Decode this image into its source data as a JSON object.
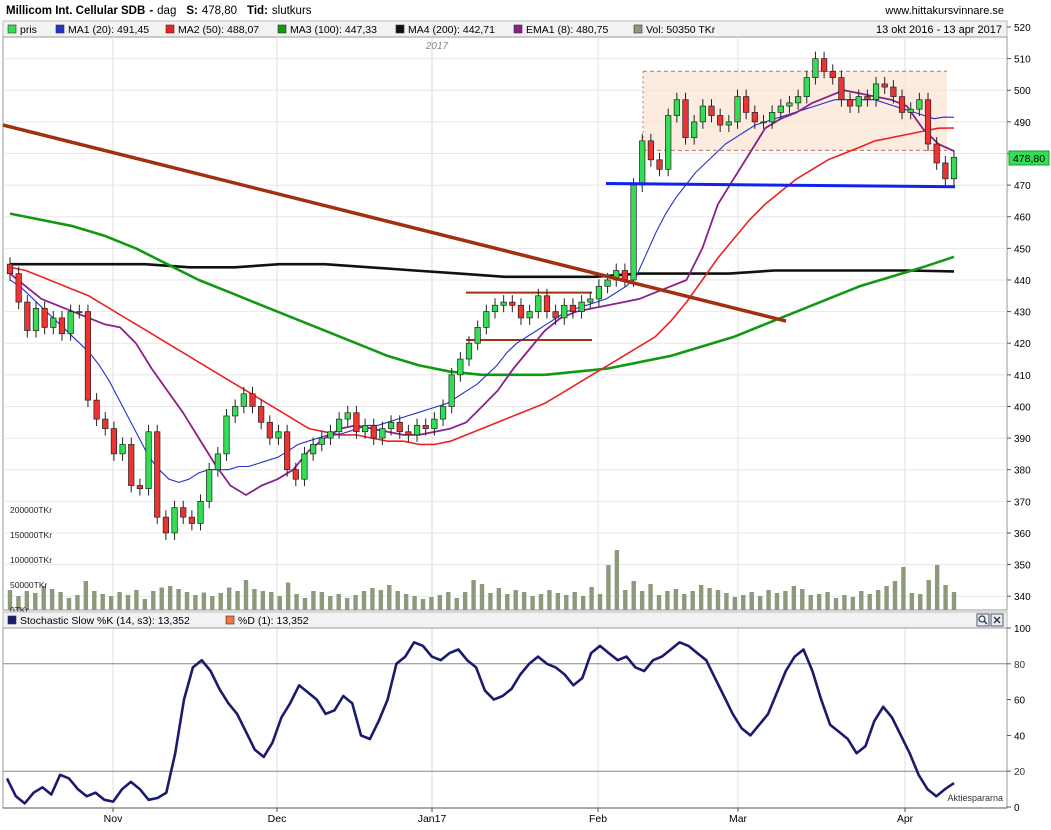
{
  "header": {
    "title": "Millicom Int. Cellular SDB",
    "sep": "-",
    "period": "dag",
    "s_label": "S:",
    "s_value": "478,80",
    "tid_label": "Tid:",
    "tid_value": "slutkurs",
    "site": "www.hittakursvinnare.se",
    "range": "13 okt 2016 - 13 apr 2017"
  },
  "legend": [
    {
      "label": "pris",
      "color": "#33dd55"
    },
    {
      "label": "MA1 (20): 491,45",
      "color": "#2233cc"
    },
    {
      "label": "MA2 (50): 488,07",
      "color": "#ee2222"
    },
    {
      "label": "MA3 (100): 447,33",
      "color": "#119911"
    },
    {
      "label": "MA4 (200): 442,71",
      "color": "#111111"
    },
    {
      "label": "EMA1 (8): 480,75",
      "color": "#882288"
    },
    {
      "label": "Vol: 50350 TKr",
      "color": "#8a9a7a"
    }
  ],
  "stoch_legend": [
    {
      "label": "Stochastic Slow %K (14, s3): 13,352",
      "color": "#1a1a6e"
    },
    {
      "label": "%D (1): 13,352",
      "color": "#ee7744"
    }
  ],
  "year_label": "2017",
  "last_price_tag": "478,80",
  "watermark": "Aktiespararna",
  "colors": {
    "up": "#33dd55",
    "down": "#ee3333",
    "ma20": "#2233cc",
    "ma50": "#ee2222",
    "ma100": "#119911",
    "ma200": "#111111",
    "ema8": "#882288",
    "volume": "#8a9a7a",
    "trend": "#a03010",
    "support": "#1122ee",
    "stoch": "#1a1a6e"
  },
  "chart_data": [
    {
      "type": "candlestick",
      "xlabels": [
        "Nov",
        "Dec",
        "Jan17",
        "Feb",
        "Mar",
        "Apr"
      ],
      "ylim": [
        335,
        520
      ],
      "yticks": [
        340,
        350,
        360,
        370,
        380,
        390,
        400,
        410,
        420,
        430,
        440,
        450,
        460,
        470,
        480,
        490,
        500,
        510,
        520
      ],
      "closes": [
        442,
        433,
        424,
        431,
        425,
        428,
        423,
        430,
        430,
        402,
        396,
        393,
        385,
        388,
        375,
        374,
        392,
        365,
        360,
        368,
        365,
        363,
        370,
        380,
        385,
        397,
        400,
        404,
        400,
        395,
        390,
        392,
        380,
        377,
        385,
        388,
        390,
        392,
        396,
        398,
        392,
        394,
        390,
        393,
        395,
        392,
        391,
        394,
        393,
        396,
        400,
        410,
        415,
        420,
        425,
        430,
        432,
        433,
        432,
        428,
        430,
        435,
        430,
        428,
        432,
        430,
        433,
        434,
        438,
        440,
        443,
        440,
        470,
        484,
        478,
        475,
        492,
        497,
        485,
        490,
        495,
        492,
        489,
        490,
        498,
        493,
        490,
        490,
        493,
        495,
        496,
        498,
        504,
        510,
        506,
        504,
        497,
        495,
        498,
        497,
        502,
        501,
        498,
        493,
        494,
        497,
        483,
        477,
        472,
        478.8
      ],
      "ma20": [
        440,
        438,
        435,
        432,
        429,
        426,
        423,
        420,
        417,
        413,
        408,
        402,
        396,
        390,
        384,
        380,
        377,
        376,
        377,
        379,
        380,
        380,
        380,
        381,
        381,
        382,
        383,
        384,
        386,
        388,
        389,
        390,
        391,
        391,
        392,
        393,
        394,
        394,
        395,
        396,
        397,
        398,
        399,
        400,
        401,
        403,
        405,
        407,
        410,
        413,
        417,
        420,
        422,
        424,
        426,
        428,
        430,
        431,
        432,
        433,
        434,
        436,
        438,
        441,
        448,
        455,
        461,
        466,
        470,
        474,
        477,
        480,
        483,
        485,
        487,
        489,
        490,
        491,
        492,
        493,
        494,
        495,
        496,
        497,
        497,
        497,
        497,
        497,
        496,
        495,
        494,
        493,
        492,
        491,
        491.5,
        491.45
      ],
      "ma50": [
        444,
        443,
        441,
        439,
        437,
        435,
        432,
        429,
        426,
        423,
        420,
        417,
        414,
        411,
        408,
        405,
        402,
        399,
        396,
        393,
        392,
        391,
        391,
        390,
        389,
        389,
        388,
        388,
        389,
        391,
        393,
        395,
        397,
        399,
        401,
        404,
        407,
        410,
        413,
        416,
        419,
        422,
        427,
        433,
        440,
        447,
        453,
        459,
        464,
        468,
        472,
        475,
        478,
        480,
        482,
        484,
        485,
        486,
        487,
        488,
        488.07
      ],
      "ma100": [
        461,
        459,
        457,
        454,
        450,
        445,
        440,
        436,
        432,
        428,
        424,
        420,
        416,
        413,
        411,
        410,
        410,
        410,
        411,
        412,
        414,
        416,
        419,
        422,
        426,
        430,
        434,
        438,
        441,
        444,
        447.33
      ],
      "ma200": [
        445,
        445,
        445,
        445,
        444,
        444,
        445,
        445,
        444,
        443,
        442,
        441,
        441,
        441,
        442,
        442,
        442,
        443,
        443,
        443,
        443,
        442.71
      ],
      "ema8": [
        442,
        438,
        434,
        432,
        430,
        428,
        426,
        425,
        420,
        412,
        405,
        398,
        390,
        382,
        375,
        372,
        375,
        377,
        380,
        386,
        390,
        393,
        394,
        393,
        392,
        391,
        391,
        392,
        393,
        395,
        400,
        405,
        412,
        418,
        424,
        428,
        430,
        431,
        432,
        433,
        434,
        436,
        438,
        440,
        450,
        464,
        472,
        480,
        488,
        491,
        493,
        496,
        498,
        500,
        499,
        498,
        497,
        495,
        488,
        483,
        480.75
      ],
      "trend_line": {
        "from": [
          0,
          489
        ],
        "to": [
          107,
          427
        ]
      },
      "resistance": 506,
      "range_bottom": 481,
      "support_line": {
        "from": [
          470.5
        ],
        "to": [
          469.5
        ]
      },
      "consolidation_top": 436,
      "consolidation_bottom": 421
    },
    {
      "type": "bar",
      "name": "Volume",
      "ylabels": [
        "200000TKr",
        "150000TKr",
        "100000TKr",
        "50000TKr",
        "0TKr"
      ],
      "values": [
        40,
        28,
        38,
        34,
        48,
        42,
        36,
        24,
        30,
        58,
        38,
        32,
        28,
        36,
        30,
        40,
        22,
        38,
        45,
        48,
        42,
        36,
        30,
        35,
        28,
        34,
        45,
        38,
        60,
        42,
        38,
        36,
        28,
        55,
        32,
        24,
        38,
        36,
        28,
        32,
        24,
        30,
        38,
        44,
        40,
        50,
        38,
        32,
        28,
        22,
        26,
        30,
        36,
        24,
        36,
        60,
        52,
        34,
        44,
        32,
        40,
        36,
        28,
        32,
        40,
        34,
        30,
        36,
        28,
        46,
        32,
        90,
        120,
        40,
        58,
        38,
        52,
        30,
        38,
        42,
        32,
        38,
        50,
        44,
        40,
        34,
        26,
        30,
        36,
        28,
        40,
        34,
        38,
        48,
        42,
        30,
        32,
        36,
        24,
        30,
        26,
        38,
        32,
        40,
        48,
        58,
        86,
        34,
        32,
        60,
        90,
        50,
        36
      ]
    },
    {
      "type": "line",
      "name": "Stochastic Slow %K (14, s3)",
      "ylim": [
        0,
        100
      ],
      "yticks": [
        0,
        20,
        40,
        60,
        80,
        100
      ],
      "reference_lines": [
        20,
        80
      ],
      "values": [
        16,
        6,
        2,
        8,
        11,
        7,
        18,
        16,
        10,
        6,
        8,
        4,
        3,
        10,
        14,
        10,
        4,
        5,
        8,
        30,
        60,
        78,
        82,
        76,
        66,
        58,
        52,
        42,
        32,
        28,
        36,
        50,
        58,
        68,
        64,
        60,
        52,
        54,
        62,
        58,
        40,
        38,
        48,
        60,
        80,
        84,
        92,
        90,
        84,
        82,
        86,
        88,
        82,
        78,
        65,
        60,
        62,
        66,
        74,
        80,
        84,
        80,
        78,
        74,
        68,
        72,
        86,
        90,
        86,
        82,
        84,
        78,
        76,
        82,
        84,
        88,
        92,
        90,
        86,
        82,
        72,
        62,
        52,
        44,
        40,
        46,
        52,
        64,
        76,
        84,
        88,
        76,
        60,
        46,
        42,
        38,
        30,
        34,
        48,
        56,
        50,
        40,
        30,
        18,
        10,
        6,
        10,
        13.352
      ]
    }
  ]
}
